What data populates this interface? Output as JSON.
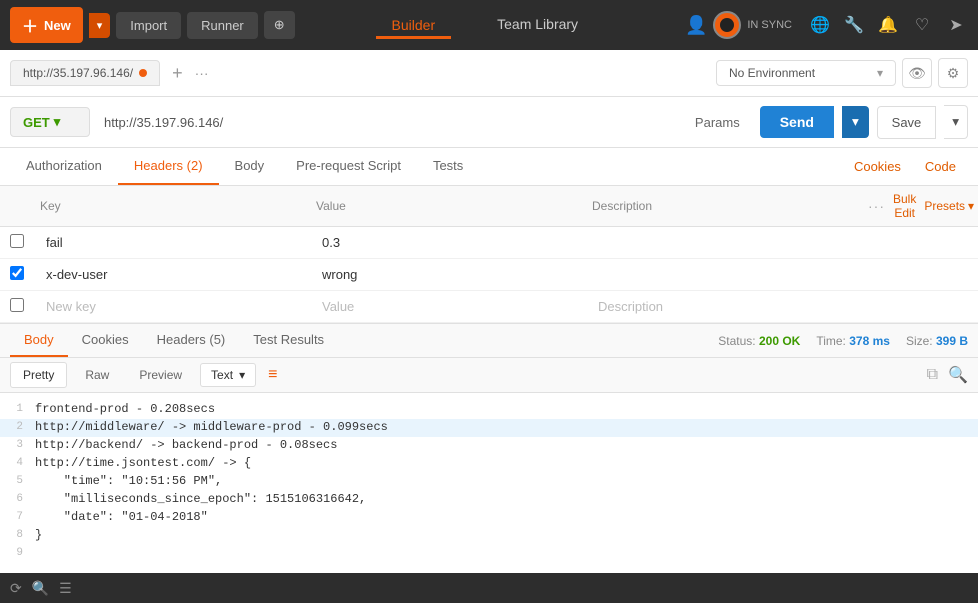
{
  "nav": {
    "new_label": "New",
    "import_label": "Import",
    "runner_label": "Runner",
    "builder_label": "Builder",
    "team_library_label": "Team Library",
    "sync_label": "IN SYNC"
  },
  "url_bar": {
    "tab_url": "http://35.197.96.146/",
    "add_btn": "+",
    "more_btn": "···"
  },
  "request": {
    "method": "GET",
    "url": "http://35.197.96.146/",
    "params_label": "Params",
    "send_label": "Send",
    "save_label": "Save"
  },
  "request_tabs": {
    "tabs": [
      {
        "label": "Authorization",
        "active": false
      },
      {
        "label": "Headers (2)",
        "active": true
      },
      {
        "label": "Body",
        "active": false
      },
      {
        "label": "Pre-request Script",
        "active": false
      },
      {
        "label": "Tests",
        "active": false
      }
    ],
    "cookies_label": "Cookies",
    "code_label": "Code"
  },
  "headers_table": {
    "col_key": "Key",
    "col_value": "Value",
    "col_desc": "Description",
    "bulk_edit_label": "Bulk Edit",
    "presets_label": "Presets",
    "rows": [
      {
        "checked": false,
        "key": "fail",
        "value": "0.3",
        "desc": ""
      },
      {
        "checked": true,
        "key": "x-dev-user",
        "value": "wrong",
        "desc": ""
      },
      {
        "checked": false,
        "key": "New key",
        "value": "Value",
        "desc": "Description",
        "placeholder": true
      }
    ]
  },
  "response": {
    "tabs": [
      {
        "label": "Body",
        "active": true
      },
      {
        "label": "Cookies",
        "active": false
      },
      {
        "label": "Headers (5)",
        "active": false
      },
      {
        "label": "Test Results",
        "active": false
      }
    ],
    "status_label": "Status:",
    "status_value": "200 OK",
    "time_label": "Time:",
    "time_value": "378 ms",
    "size_label": "Size:",
    "size_value": "399 B"
  },
  "response_toolbar": {
    "pretty_label": "Pretty",
    "raw_label": "Raw",
    "preview_label": "Preview",
    "text_label": "Text",
    "wrap_icon": "≡"
  },
  "code_lines": [
    {
      "num": 1,
      "content": "frontend-prod - 0.208secs",
      "highlighted": false
    },
    {
      "num": 2,
      "content": "http://middleware/ -> middleware-prod - 0.099secs",
      "highlighted": true
    },
    {
      "num": 3,
      "content": "http://backend/ -> backend-prod - 0.08secs",
      "highlighted": false
    },
    {
      "num": 4,
      "content": "http://time.jsontest.com/ -> {",
      "highlighted": false
    },
    {
      "num": 5,
      "content": "    \"time\": \"10:51:56 PM\",",
      "highlighted": false
    },
    {
      "num": 6,
      "content": "    \"milliseconds_since_epoch\": 1515106316642,",
      "highlighted": false
    },
    {
      "num": 7,
      "content": "    \"date\": \"01-04-2018\"",
      "highlighted": false
    },
    {
      "num": 8,
      "content": "}",
      "highlighted": false
    },
    {
      "num": 9,
      "content": "",
      "highlighted": false
    }
  ],
  "env": {
    "placeholder": "No Environment",
    "eye_icon": "👁",
    "gear_icon": "⚙"
  }
}
